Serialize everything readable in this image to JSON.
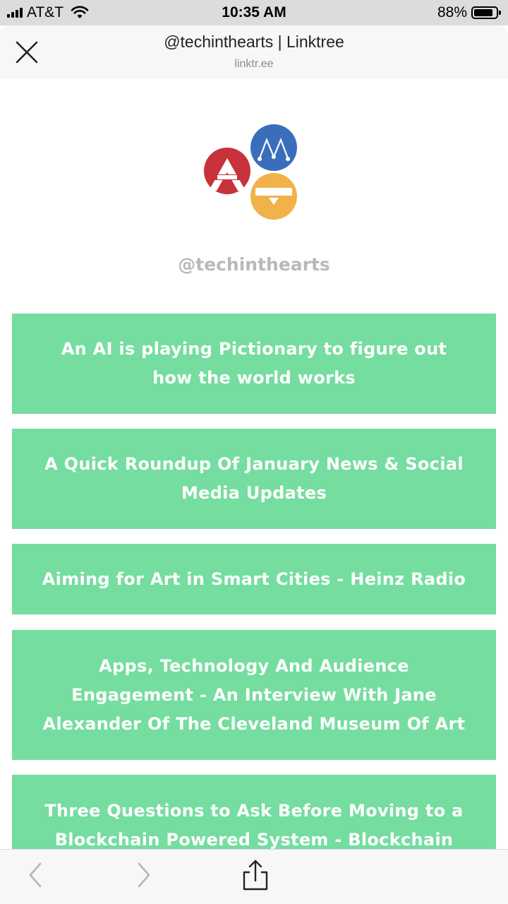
{
  "status_bar": {
    "carrier": "AT&T",
    "time": "10:35 AM",
    "battery_percent": "88%",
    "battery_level": 0.88,
    "signal_icon": "signal-bars-icon",
    "wifi_icon": "wifi-icon",
    "battery_icon": "battery-icon"
  },
  "header": {
    "close_icon": "close-icon",
    "title": "@techinthearts | Linktree",
    "url": "linktr.ee"
  },
  "profile": {
    "logo_icon": "techinthearts-logo",
    "handle": "@techinthearts"
  },
  "links": [
    {
      "label": "An AI is playing Pictionary to figure out how the world works"
    },
    {
      "label": "A Quick Roundup Of January News & Social Media Updates"
    },
    {
      "label": "Aiming for Art in Smart Cities - Heinz Radio"
    },
    {
      "label": "Apps, Technology And Audience Engagement - An Interview With Jane Alexander Of The Cleveland Museum Of Art"
    },
    {
      "label": "Three Questions to Ask Before Moving to a Blockchain Powered System - Blockchain Ex-"
    }
  ],
  "toolbar": {
    "back_icon": "chevron-left-icon",
    "forward_icon": "chevron-right-icon",
    "share_icon": "share-icon"
  },
  "colors": {
    "link_button": "#75dd9f",
    "logo_red": "#c8323a",
    "logo_blue": "#3a6ebd",
    "logo_yellow": "#f1b24a",
    "handle_text": "#b9b9b9"
  }
}
